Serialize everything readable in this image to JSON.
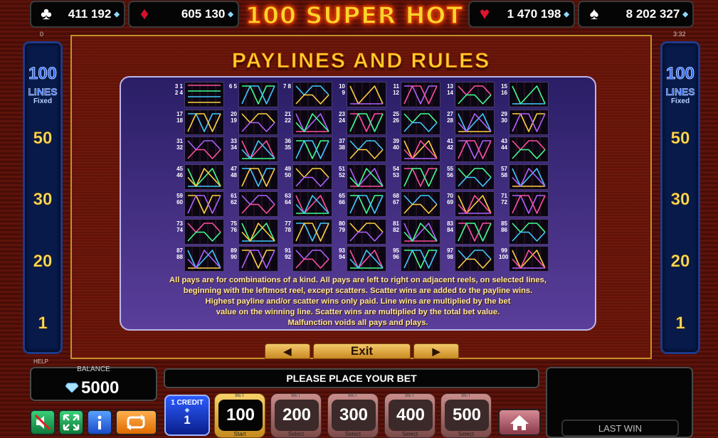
{
  "header": {
    "title": "100 SUPER HOT",
    "jackpots": [
      {
        "suit": "clubs",
        "symbol": "♣",
        "value": "411 192"
      },
      {
        "suit": "diamonds",
        "symbol": "♦",
        "value": "605 130"
      },
      {
        "suit": "hearts",
        "symbol": "♥",
        "value": "1 470 198"
      },
      {
        "suit": "spades",
        "symbol": "♠",
        "value": "8 202 327"
      }
    ],
    "left_small": "0",
    "right_small": "3:32"
  },
  "side_panel": {
    "lines_count": "100",
    "lines_label": "LINES",
    "fixed_label": "Fixed",
    "options": [
      "50",
      "30",
      "20",
      "1"
    ]
  },
  "main": {
    "heading": "PAYLINES AND RULES",
    "payline_labels": [
      [
        "3 1 2 4",
        "6 5",
        "7 8",
        "10 9",
        "11 12",
        "13 14",
        "15 16"
      ],
      [
        "17 18",
        "20 19",
        "21 22",
        "23 24",
        "25 26",
        "27 28",
        "29 30"
      ],
      [
        "31 32",
        "33 34",
        "36 35",
        "37 38",
        "39 40",
        "41 42",
        "43 44"
      ],
      [
        "45 46",
        "47 48",
        "49 50",
        "51 52",
        "54 53",
        "55 56",
        "57 58"
      ],
      [
        "59 60",
        "61 62",
        "63 64",
        "65 66",
        "68 67",
        "70 69",
        "71 72"
      ],
      [
        "73 74",
        "75 76",
        "77 78",
        "80 79",
        "81 82",
        "83 84",
        "85 86"
      ],
      [
        "87 88",
        "89 90",
        "91 92",
        "93 94",
        "95 96",
        "97 98",
        "99 100"
      ]
    ],
    "rules_lines": [
      "All pays are for combinations of a kind. All pays are left to right on adjacent reels, on selected lines,",
      "beginning with the leftmost reel, except scatters. Scatter wins are added to the payline wins.",
      "Highest payline and/or scatter wins only paid. Line wins are multiplied by the bet",
      "value on the winning line. Scatter wins are multiplied by the total bet value.",
      "Malfunction voids all pays and plays."
    ],
    "prev_icon": "left-arrow-icon",
    "exit_label": "Exit",
    "next_icon": "right-arrow-icon"
  },
  "footer": {
    "help_label": "HELP",
    "balance_label": "BALANCE",
    "balance_value": "5000",
    "message": "PLEASE PLACE YOUR BET",
    "credit_label": "1 CREDIT",
    "credit_value": "1",
    "bets": [
      {
        "caption": "BET",
        "value": "100",
        "action": "Start",
        "active": true
      },
      {
        "caption": "BET",
        "value": "200",
        "action": "Select",
        "active": false
      },
      {
        "caption": "BET",
        "value": "300",
        "action": "Select",
        "active": false
      },
      {
        "caption": "BET",
        "value": "400",
        "action": "Select",
        "active": false
      },
      {
        "caption": "BET",
        "value": "500",
        "action": "Select",
        "active": false
      }
    ],
    "last_win_label": "LAST WIN"
  },
  "colors": {
    "accent_gold": "#ffd42a",
    "panel_blue": "#071a4a",
    "background_red": "#6b1509"
  }
}
